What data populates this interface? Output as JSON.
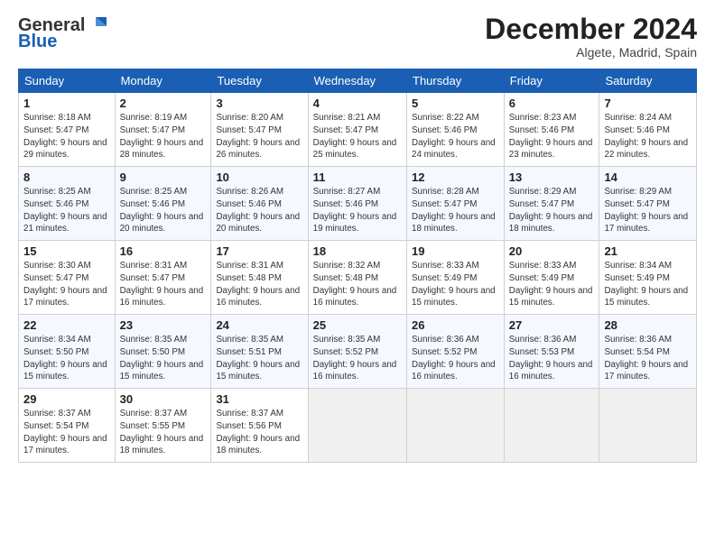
{
  "header": {
    "logo_general": "General",
    "logo_blue": "Blue",
    "month_title": "December 2024",
    "location": "Algete, Madrid, Spain"
  },
  "days_of_week": [
    "Sunday",
    "Monday",
    "Tuesday",
    "Wednesday",
    "Thursday",
    "Friday",
    "Saturday"
  ],
  "weeks": [
    [
      {
        "num": "1",
        "sunrise": "8:18 AM",
        "sunset": "5:47 PM",
        "daylight": "9 hours and 29 minutes."
      },
      {
        "num": "2",
        "sunrise": "8:19 AM",
        "sunset": "5:47 PM",
        "daylight": "9 hours and 28 minutes."
      },
      {
        "num": "3",
        "sunrise": "8:20 AM",
        "sunset": "5:47 PM",
        "daylight": "9 hours and 26 minutes."
      },
      {
        "num": "4",
        "sunrise": "8:21 AM",
        "sunset": "5:47 PM",
        "daylight": "9 hours and 25 minutes."
      },
      {
        "num": "5",
        "sunrise": "8:22 AM",
        "sunset": "5:46 PM",
        "daylight": "9 hours and 24 minutes."
      },
      {
        "num": "6",
        "sunrise": "8:23 AM",
        "sunset": "5:46 PM",
        "daylight": "9 hours and 23 minutes."
      },
      {
        "num": "7",
        "sunrise": "8:24 AM",
        "sunset": "5:46 PM",
        "daylight": "9 hours and 22 minutes."
      }
    ],
    [
      {
        "num": "8",
        "sunrise": "8:25 AM",
        "sunset": "5:46 PM",
        "daylight": "9 hours and 21 minutes."
      },
      {
        "num": "9",
        "sunrise": "8:25 AM",
        "sunset": "5:46 PM",
        "daylight": "9 hours and 20 minutes."
      },
      {
        "num": "10",
        "sunrise": "8:26 AM",
        "sunset": "5:46 PM",
        "daylight": "9 hours and 20 minutes."
      },
      {
        "num": "11",
        "sunrise": "8:27 AM",
        "sunset": "5:46 PM",
        "daylight": "9 hours and 19 minutes."
      },
      {
        "num": "12",
        "sunrise": "8:28 AM",
        "sunset": "5:47 PM",
        "daylight": "9 hours and 18 minutes."
      },
      {
        "num": "13",
        "sunrise": "8:29 AM",
        "sunset": "5:47 PM",
        "daylight": "9 hours and 18 minutes."
      },
      {
        "num": "14",
        "sunrise": "8:29 AM",
        "sunset": "5:47 PM",
        "daylight": "9 hours and 17 minutes."
      }
    ],
    [
      {
        "num": "15",
        "sunrise": "8:30 AM",
        "sunset": "5:47 PM",
        "daylight": "9 hours and 17 minutes."
      },
      {
        "num": "16",
        "sunrise": "8:31 AM",
        "sunset": "5:47 PM",
        "daylight": "9 hours and 16 minutes."
      },
      {
        "num": "17",
        "sunrise": "8:31 AM",
        "sunset": "5:48 PM",
        "daylight": "9 hours and 16 minutes."
      },
      {
        "num": "18",
        "sunrise": "8:32 AM",
        "sunset": "5:48 PM",
        "daylight": "9 hours and 16 minutes."
      },
      {
        "num": "19",
        "sunrise": "8:33 AM",
        "sunset": "5:49 PM",
        "daylight": "9 hours and 15 minutes."
      },
      {
        "num": "20",
        "sunrise": "8:33 AM",
        "sunset": "5:49 PM",
        "daylight": "9 hours and 15 minutes."
      },
      {
        "num": "21",
        "sunrise": "8:34 AM",
        "sunset": "5:49 PM",
        "daylight": "9 hours and 15 minutes."
      }
    ],
    [
      {
        "num": "22",
        "sunrise": "8:34 AM",
        "sunset": "5:50 PM",
        "daylight": "9 hours and 15 minutes."
      },
      {
        "num": "23",
        "sunrise": "8:35 AM",
        "sunset": "5:50 PM",
        "daylight": "9 hours and 15 minutes."
      },
      {
        "num": "24",
        "sunrise": "8:35 AM",
        "sunset": "5:51 PM",
        "daylight": "9 hours and 15 minutes."
      },
      {
        "num": "25",
        "sunrise": "8:35 AM",
        "sunset": "5:52 PM",
        "daylight": "9 hours and 16 minutes."
      },
      {
        "num": "26",
        "sunrise": "8:36 AM",
        "sunset": "5:52 PM",
        "daylight": "9 hours and 16 minutes."
      },
      {
        "num": "27",
        "sunrise": "8:36 AM",
        "sunset": "5:53 PM",
        "daylight": "9 hours and 16 minutes."
      },
      {
        "num": "28",
        "sunrise": "8:36 AM",
        "sunset": "5:54 PM",
        "daylight": "9 hours and 17 minutes."
      }
    ],
    [
      {
        "num": "29",
        "sunrise": "8:37 AM",
        "sunset": "5:54 PM",
        "daylight": "9 hours and 17 minutes."
      },
      {
        "num": "30",
        "sunrise": "8:37 AM",
        "sunset": "5:55 PM",
        "daylight": "9 hours and 18 minutes."
      },
      {
        "num": "31",
        "sunrise": "8:37 AM",
        "sunset": "5:56 PM",
        "daylight": "9 hours and 18 minutes."
      },
      null,
      null,
      null,
      null
    ]
  ]
}
